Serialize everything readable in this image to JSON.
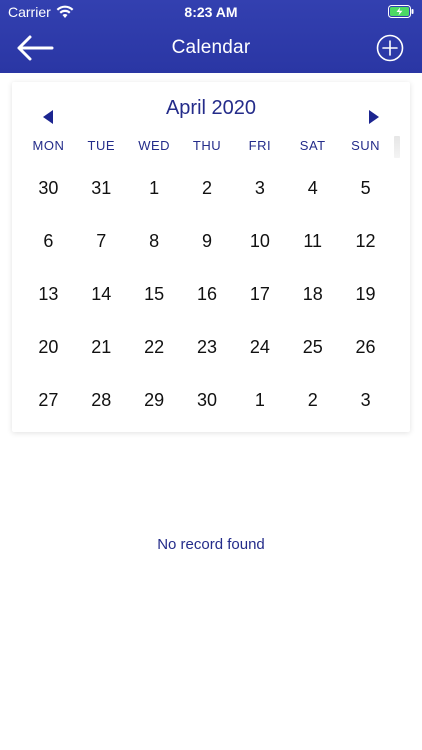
{
  "status_bar": {
    "carrier": "Carrier",
    "time": "8:23 AM",
    "wifi_icon": "wifi-icon",
    "battery_icon": "battery-charging-icon"
  },
  "nav": {
    "title": "Calendar",
    "back_icon": "arrow-left-icon",
    "add_icon": "plus-circle-icon"
  },
  "calendar": {
    "month_label": "April 2020",
    "prev_icon": "triangle-left-icon",
    "next_icon": "triangle-right-icon",
    "weekdays": [
      "MON",
      "TUE",
      "WED",
      "THU",
      "FRI",
      "SAT",
      "SUN"
    ],
    "weeks": [
      [
        "30",
        "31",
        "1",
        "2",
        "3",
        "4",
        "5"
      ],
      [
        "6",
        "7",
        "8",
        "9",
        "10",
        "11",
        "12"
      ],
      [
        "13",
        "14",
        "15",
        "16",
        "17",
        "18",
        "19"
      ],
      [
        "20",
        "21",
        "22",
        "23",
        "24",
        "25",
        "26"
      ],
      [
        "27",
        "28",
        "29",
        "30",
        "1",
        "2",
        "3"
      ]
    ]
  },
  "records": {
    "empty_message": "No record found"
  },
  "colors": {
    "header_bg": "#2f3ba8",
    "accent": "#242c8a",
    "text": "#111111"
  }
}
